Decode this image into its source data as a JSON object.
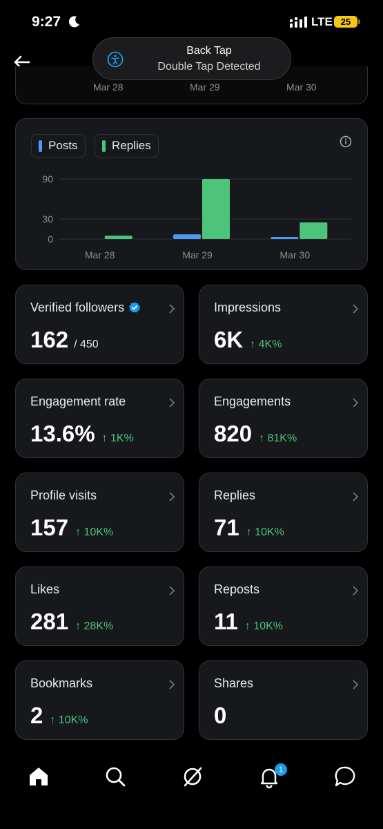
{
  "status_bar": {
    "time": "9:27",
    "network": "LTE",
    "battery": "25"
  },
  "toast": {
    "title": "Back Tap",
    "subtitle": "Double Tap Detected"
  },
  "top_chart_labels": [
    "Mar 28",
    "Mar 29",
    "Mar 30"
  ],
  "chart": {
    "legend": [
      "Posts",
      "Replies"
    ],
    "colors": {
      "posts": "#4c9bf5",
      "replies": "#4ec47a"
    }
  },
  "chart_data": {
    "type": "bar",
    "categories": [
      "Mar 28",
      "Mar 29",
      "Mar 30"
    ],
    "series": [
      {
        "name": "Posts",
        "values": [
          0,
          7,
          3
        ]
      },
      {
        "name": "Replies",
        "values": [
          5,
          90,
          25
        ]
      }
    ],
    "y_ticks": [
      "90",
      "30",
      "0"
    ],
    "ylim": [
      0,
      90
    ]
  },
  "stats": [
    {
      "label": "Verified followers",
      "value": "162",
      "of": "/ 450",
      "change": ""
    },
    {
      "label": "Impressions",
      "value": "6K",
      "change": "↑ 4K%"
    },
    {
      "label": "Engagement rate",
      "value": "13.6%",
      "change": "↑ 1K%"
    },
    {
      "label": "Engagements",
      "value": "820",
      "change": "↑ 81K%"
    },
    {
      "label": "Profile visits",
      "value": "157",
      "change": "↑ 10K%"
    },
    {
      "label": "Replies",
      "value": "71",
      "change": "↑ 10K%"
    },
    {
      "label": "Likes",
      "value": "281",
      "change": "↑ 28K%"
    },
    {
      "label": "Reposts",
      "value": "11",
      "change": "↑ 10K%"
    },
    {
      "label": "Bookmarks",
      "value": "2",
      "change": "↑ 10K%"
    },
    {
      "label": "Shares",
      "value": "0",
      "change": ""
    }
  ],
  "nav": {
    "notification_count": "1"
  },
  "accent": "#1d9bf0"
}
